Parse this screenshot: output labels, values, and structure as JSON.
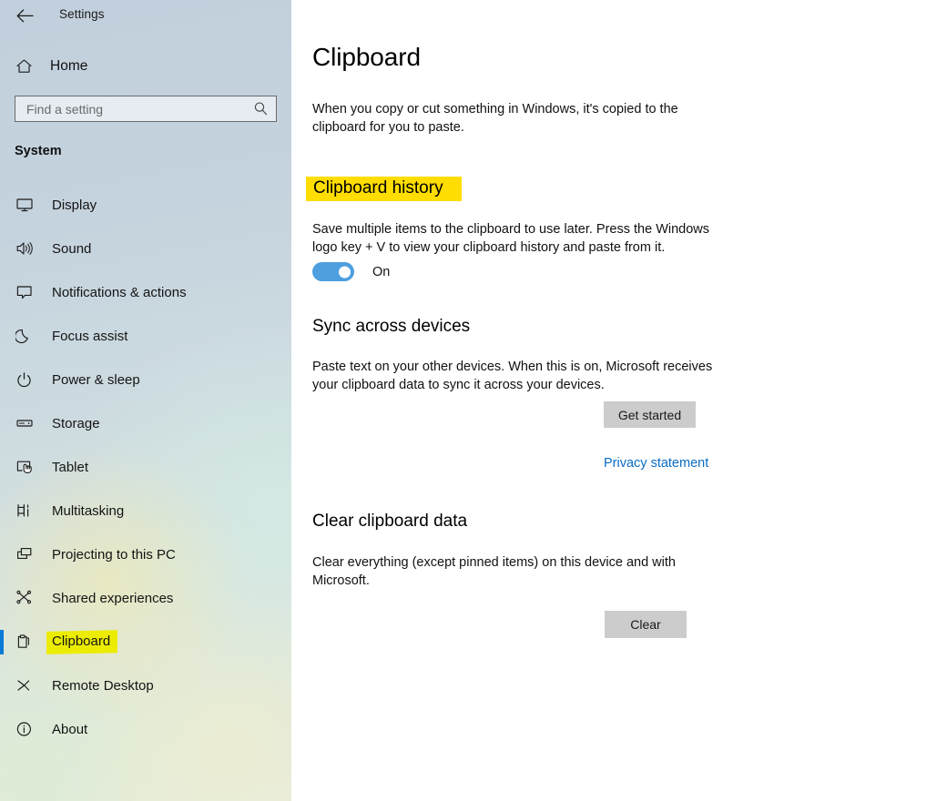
{
  "window": {
    "title": "Settings",
    "back_icon": "back-arrow-icon"
  },
  "sidebar": {
    "home": {
      "label": "Home",
      "icon": "home-icon"
    },
    "search": {
      "placeholder": "Find a setting",
      "value": "",
      "icon": "search-icon"
    },
    "group_label": "System",
    "items": [
      {
        "label": "Display",
        "icon": "monitor-icon",
        "selected": false
      },
      {
        "label": "Sound",
        "icon": "speaker-icon",
        "selected": false
      },
      {
        "label": "Notifications & actions",
        "icon": "notification-balloon-icon",
        "selected": false
      },
      {
        "label": "Focus assist",
        "icon": "moon-icon",
        "selected": false
      },
      {
        "label": "Power & sleep",
        "icon": "power-icon",
        "selected": false
      },
      {
        "label": "Storage",
        "icon": "drive-icon",
        "selected": false
      },
      {
        "label": "Tablet",
        "icon": "tablet-hand-icon",
        "selected": false
      },
      {
        "label": "Multitasking",
        "icon": "multitasking-icon",
        "selected": false
      },
      {
        "label": "Projecting to this PC",
        "icon": "projecting-screens-icon",
        "selected": false
      },
      {
        "label": "Shared experiences",
        "icon": "shared-nodes-icon",
        "selected": false
      },
      {
        "label": "Clipboard",
        "icon": "clipboard-icon",
        "selected": true
      },
      {
        "label": "Remote Desktop",
        "icon": "remote-desktop-icon",
        "selected": false
      },
      {
        "label": "About",
        "icon": "info-circle-icon",
        "selected": false
      }
    ]
  },
  "main": {
    "page_title": "Clipboard",
    "intro": "When you copy or cut something in Windows, it's copied to the clipboard for you to paste.",
    "clipboard_history": {
      "heading": "Clipboard history",
      "description": "Save multiple items to the clipboard to use later. Press the Windows logo key + V to view your clipboard history and paste from it.",
      "toggle_state": "On"
    },
    "sync": {
      "heading": "Sync across devices",
      "description": "Paste text on your other devices. When this is on, Microsoft receives your clipboard data to sync it across your devices.",
      "button_label": "Get started",
      "privacy_link": "Privacy statement"
    },
    "clear": {
      "heading": "Clear clipboard data",
      "description": "Clear everything (except pinned items) on this device and with Microsoft.",
      "button_label": "Clear"
    }
  },
  "highlights": {
    "sidebar_item_color": "#ecec00",
    "heading_color": "#ffdd00"
  },
  "colors": {
    "accent": "#0a7ad8",
    "toggle_on": "#4d9fe0",
    "link": "#0a6cc4",
    "button_face": "#cccccc"
  }
}
